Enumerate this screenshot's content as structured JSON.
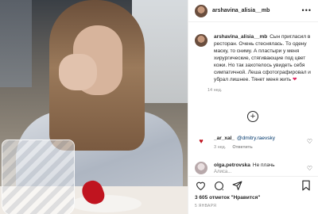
{
  "post": {
    "username": "arshavina_alisia__mb",
    "more_icon": "more-icon"
  },
  "caption": {
    "username": "arshavina_alisia__mb",
    "text": "Сын пригласил в ресторан. Очень стеснялась. То одену маску, то сниму. А пластыри у меня хирургические, стягивающие под цвет кожи. Но так захотелось увидеть себя симпатичной. Леша сфотографировал и убрал лишнее. Тянет меня жить",
    "emoji": "❤",
    "time": "14 нед."
  },
  "load_more": {
    "icon": "plus-circle-icon"
  },
  "comments": [
    {
      "username": "_ar_xal_",
      "mention": "@dmitry.raevsky",
      "time": "3 нед.",
      "reply_label": "Ответить"
    },
    {
      "username": "olga.petrovska",
      "text": "Не плачь",
      "text2": "Алиса..."
    }
  ],
  "actions": {
    "like_icon": "heart-icon",
    "comment_icon": "comment-icon",
    "share_icon": "share-icon",
    "save_icon": "bookmark-icon"
  },
  "likes_text": "3 605 отметок \"Нравится\"",
  "date": "5 ЯНВАРЯ"
}
